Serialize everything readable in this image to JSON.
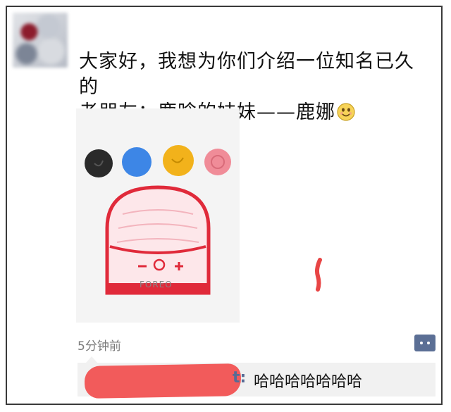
{
  "post": {
    "text_line1": "大家好，我想为你们介绍一位知名已久的",
    "text_line2": "老朋友：鹿晗的妹妹——鹿娜",
    "emoji": "smiley-face-icon",
    "image_label": "FOREO",
    "timestamp": "5分钟前"
  },
  "comment": {
    "name_tail": "t:",
    "text": "哈哈哈哈哈哈哈"
  },
  "colors": {
    "link_blue": "#576b95",
    "redaction_red": "#f25b5b",
    "device_red": "#e02a3a",
    "dot_black": "#2a2a2a",
    "dot_blue": "#3d86e6",
    "dot_yellow": "#f2b21b",
    "dot_pink": "#f08c98"
  }
}
